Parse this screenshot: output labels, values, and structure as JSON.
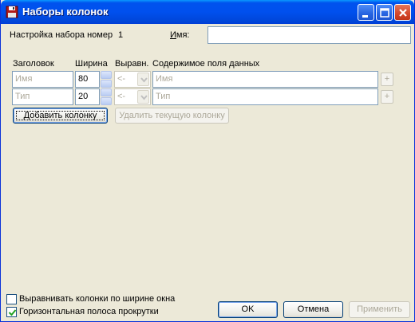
{
  "window": {
    "title": "Наборы колонок",
    "minimize_icon": "minimize-icon",
    "maximize_icon": "maximize-icon",
    "close_icon": "close-icon",
    "app_icon": "save-disk-icon"
  },
  "top": {
    "set_label": "Настройка набора номер",
    "set_number": "1",
    "name_label": "Имя:",
    "name_value": ""
  },
  "columns_header": {
    "heading": "Заголовок",
    "width": "Ширина",
    "align": "Выравн.",
    "content": "Содержимое поля данных"
  },
  "rows": [
    {
      "heading": "Имя",
      "width": "80",
      "align": "<-",
      "content": "Имя",
      "plus": "+"
    },
    {
      "heading": "Тип",
      "width": "20",
      "align": "<-",
      "content": "Тип",
      "plus": "+"
    }
  ],
  "actions": {
    "add_column": "Добавить колонку",
    "delete_column": "Удалить текущую колонку"
  },
  "options": {
    "fit_columns": {
      "label": "Выравнивать колонки по ширине окна",
      "checked": false
    },
    "h_scroll": {
      "label": "Горизонтальная полоса прокрутки",
      "checked": true
    }
  },
  "buttons": {
    "ok": "OK",
    "cancel": "Отмена",
    "apply": "Применить"
  },
  "colors": {
    "titlebar": "#0053ee",
    "dialog_bg": "#ece9d8",
    "disabled_text": "#aca899"
  }
}
